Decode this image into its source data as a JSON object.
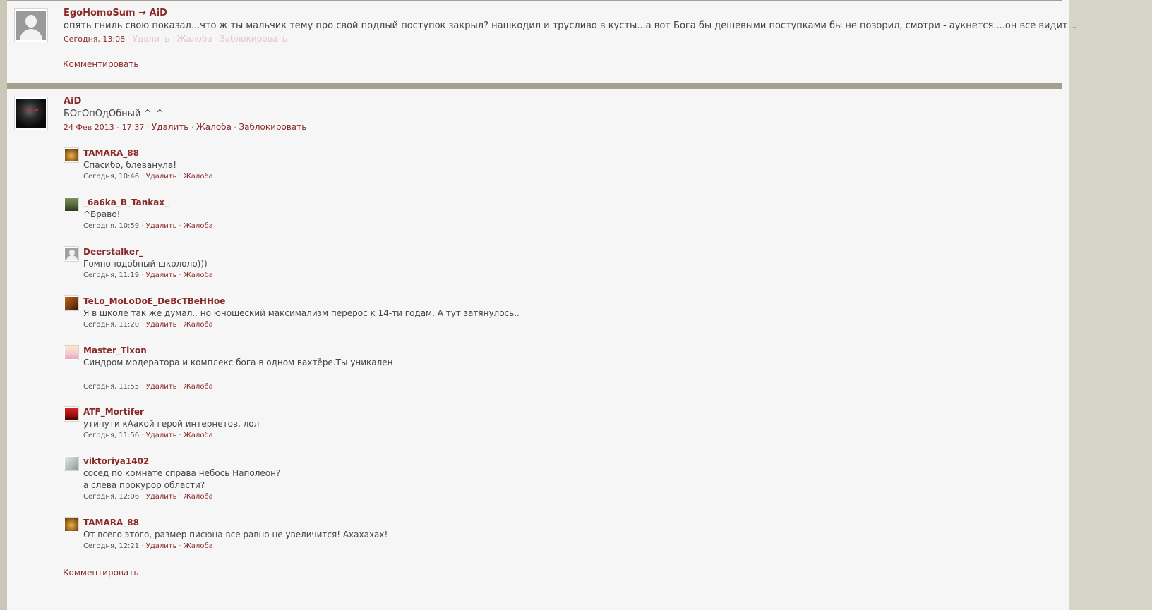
{
  "top_post": {
    "author": "EgoHomoSum",
    "arrow": "→",
    "recipient": "AiD",
    "text": "опять гниль свою показал...что ж ты мальчик тему про свой подлый поступок закрыл? нашкодил и трусливо в кусты...а вот Бога бы дешевыми поступками бы не позорил, смотри - аукнется....он все видит...",
    "time": "Сегодня, 13:08",
    "actions": {
      "delete": "Удалить",
      "report": "Жалоба",
      "block": "Заблокировать"
    },
    "comment_link": "Комментировать"
  },
  "main_post": {
    "author": "AiD",
    "text": "БОгОпОдОбный ^_^",
    "time": "24 Фев 2013 - 17:37",
    "actions": {
      "delete": "Удалить",
      "report": "Жалоба",
      "block": "Заблокировать"
    },
    "comment_link": "Комментировать"
  },
  "replies": [
    {
      "author": "TAMARA_88",
      "lines": [
        "Спасибо, блеванула!"
      ],
      "time": "Сегодня, 10:46",
      "delete": "Удалить",
      "report": "Жалоба",
      "avatar_icon": "bear-avatar-icon"
    },
    {
      "author": "_6a6ka_B_Tankax_",
      "lines": [
        "^Браво!"
      ],
      "time": "Сегодня, 10:59",
      "delete": "Удалить",
      "report": "Жалоба",
      "avatar_icon": "tank-avatar-icon"
    },
    {
      "author": "Deerstalker_",
      "lines": [
        "Гомноподобный школоло)))"
      ],
      "time": "Сегодня, 11:19",
      "delete": "Удалить",
      "report": "Жалоба",
      "avatar_icon": "default-user-icon"
    },
    {
      "author": "TeLo_MoLoDoE_DeBcTBeHHoe",
      "lines": [
        "Я в школе так же думал.. но юношеский максимализм перерос к 14-ти годам. А тут затянулось.."
      ],
      "time": "Сегодня, 11:20",
      "delete": "Удалить",
      "report": "Жалоба",
      "avatar_icon": "photo-avatar-icon"
    },
    {
      "author": "Master_Tixon",
      "lines": [
        "Синдром модератора и комплекс бога в одном вахтёре.Ты уникален"
      ],
      "time": "Сегодня, 11:55",
      "delete": "Удалить",
      "report": "Жалоба",
      "avatar_icon": "anime-avatar-icon"
    },
    {
      "author": "ATF_Mortifer",
      "lines": [
        "утипути кАакой герой интернетов, лол"
      ],
      "time": "Сегодня, 11:56",
      "delete": "Удалить",
      "report": "Жалоба",
      "avatar_icon": "red-avatar-icon"
    },
    {
      "author": "viktoriya1402",
      "lines": [
        "сосед по комнате справа небось Наполеон?",
        "а слева прокурор области?"
      ],
      "time": "Сегодня, 12:06",
      "delete": "Удалить",
      "report": "Жалоба",
      "avatar_icon": "photo-avatar-icon"
    },
    {
      "author": "TAMARA_88",
      "lines": [
        "От всего этого, размер писюна все равно не увеличится! Ахахахах!"
      ],
      "time": "Сегодня, 12:21",
      "delete": "Удалить",
      "report": "Жалоба",
      "avatar_icon": "bear-avatar-icon"
    }
  ],
  "colors": {
    "link": "#8a2a2a",
    "separator": "#a3a090",
    "page_bg": "#f6f6f6",
    "side_bg": "#d7d5c7"
  }
}
